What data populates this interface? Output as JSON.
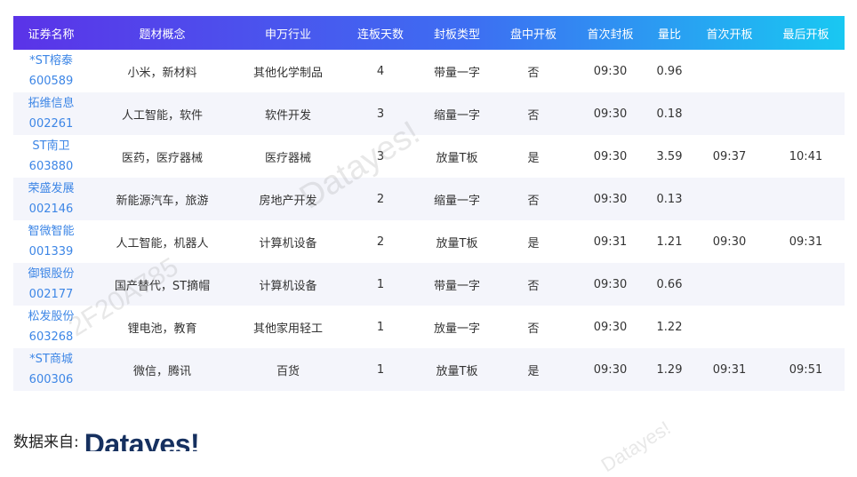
{
  "table": {
    "headers": [
      "证券名称",
      "题材概念",
      "申万行业",
      "连板天数",
      "封板类型",
      "盘中开板",
      "首次封板",
      "量比",
      "首次开板",
      "最后开板"
    ],
    "rows": [
      {
        "name": "*ST榕泰",
        "code": "600589",
        "concept": "小米，新材料",
        "industry": "其他化学制品",
        "days": "4",
        "type": "带量一字",
        "opened": "否",
        "first_seal": "09:30",
        "vol_ratio": "0.96",
        "first_open": "",
        "last_open": ""
      },
      {
        "name": "拓维信息",
        "code": "002261",
        "concept": "人工智能，软件",
        "industry": "软件开发",
        "days": "3",
        "type": "缩量一字",
        "opened": "否",
        "first_seal": "09:30",
        "vol_ratio": "0.18",
        "first_open": "",
        "last_open": ""
      },
      {
        "name": "ST南卫",
        "code": "603880",
        "concept": "医药，医疗器械",
        "industry": "医疗器械",
        "days": "3",
        "type": "放量T板",
        "opened": "是",
        "first_seal": "09:30",
        "vol_ratio": "3.59",
        "first_open": "09:37",
        "last_open": "10:41"
      },
      {
        "name": "荣盛发展",
        "code": "002146",
        "concept": "新能源汽车，旅游",
        "industry": "房地产开发",
        "days": "2",
        "type": "缩量一字",
        "opened": "否",
        "first_seal": "09:30",
        "vol_ratio": "0.13",
        "first_open": "",
        "last_open": ""
      },
      {
        "name": "智微智能",
        "code": "001339",
        "concept": "人工智能，机器人",
        "industry": "计算机设备",
        "days": "2",
        "type": "放量T板",
        "opened": "是",
        "first_seal": "09:31",
        "vol_ratio": "1.21",
        "first_open": "09:30",
        "last_open": "09:31"
      },
      {
        "name": "御银股份",
        "code": "002177",
        "concept": "国产替代，ST摘帽",
        "industry": "计算机设备",
        "days": "1",
        "type": "带量一字",
        "opened": "否",
        "first_seal": "09:30",
        "vol_ratio": "0.66",
        "first_open": "",
        "last_open": ""
      },
      {
        "name": "松发股份",
        "code": "603268",
        "concept": "锂电池，教育",
        "industry": "其他家用轻工",
        "days": "1",
        "type": "放量一字",
        "opened": "否",
        "first_seal": "09:30",
        "vol_ratio": "1.22",
        "first_open": "",
        "last_open": ""
      },
      {
        "name": "*ST商城",
        "code": "600306",
        "concept": "微信，腾讯",
        "industry": "百货",
        "days": "1",
        "type": "放量T板",
        "opened": "是",
        "first_seal": "09:30",
        "vol_ratio": "1.29",
        "first_open": "09:31",
        "last_open": "09:51"
      }
    ]
  },
  "watermarks": [
    "Datayes!",
    "2F20A785",
    "Datayes!"
  ],
  "footer": {
    "source_label": "数据来自:",
    "logo_text": "Datayes!"
  },
  "colors": {
    "header_start": "#5b33e8",
    "header_end": "#19c8f2",
    "link": "#3d86e6",
    "row_alt": "#f4f5fb"
  }
}
